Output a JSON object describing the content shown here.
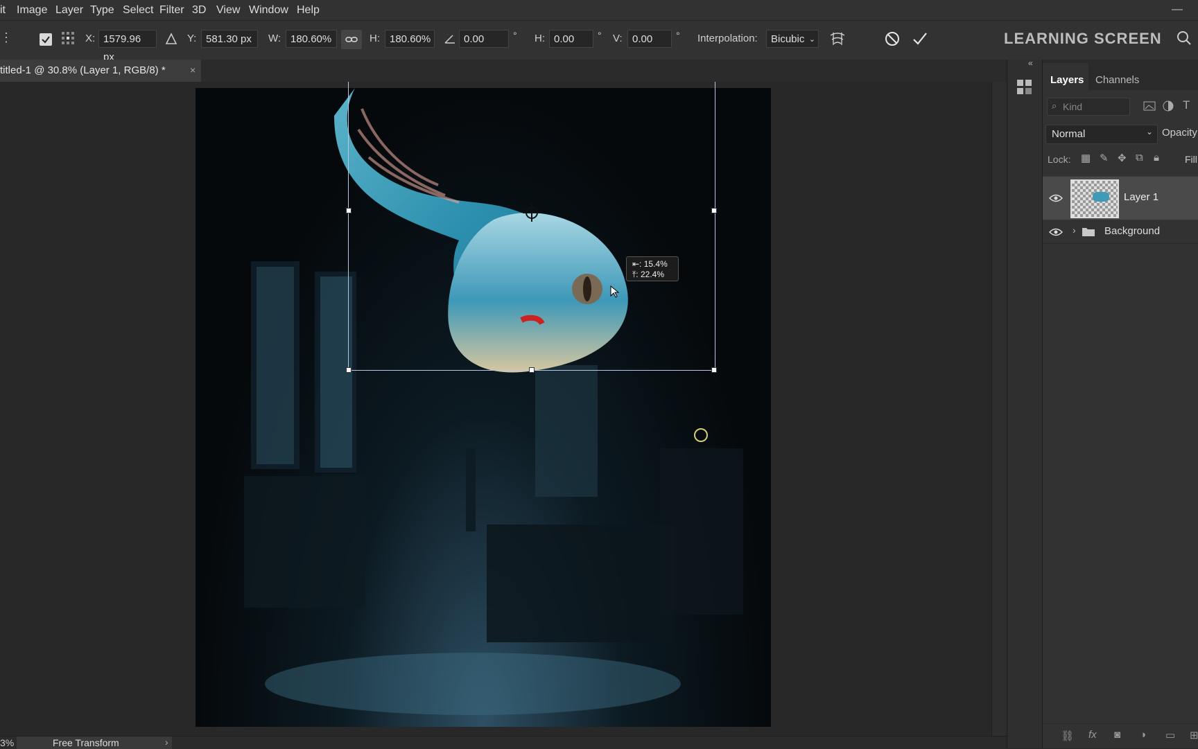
{
  "menu": [
    "it",
    "Image",
    "Layer",
    "Type",
    "Select",
    "Filter",
    "3D",
    "View",
    "Window",
    "Help"
  ],
  "options": {
    "x_label": "X:",
    "x_value": "1579.96 px",
    "y_label": "Y:",
    "y_value": "581.30 px",
    "w_label": "W:",
    "w_value": "180.60%",
    "h_label": "H:",
    "h_value": "180.60%",
    "angle_value": "0.00",
    "skew_h_label": "H:",
    "skew_h_value": "0.00",
    "skew_v_label": "V:",
    "skew_v_value": "0.00",
    "deg_symbol": "°",
    "interpolation_label": "Interpolation:",
    "interpolation_value": "Bicubic"
  },
  "brand": "LEARNING SCREEN",
  "document_tab": "titled-1 @ 30.8% (Layer 1, RGB/8) *",
  "transform_tooltip": {
    "line1": "⇤: 15.4%",
    "line2": "⤒: 22.4%"
  },
  "panel": {
    "tabs": [
      "Layers",
      "Channels"
    ],
    "filter_placeholder": "Kind",
    "blend_mode": "Normal",
    "opacity_label": "Opacity",
    "lock_label": "Lock:",
    "fill_label": "Fill",
    "layers": [
      {
        "name": "Layer 1",
        "visible": true,
        "selected": true
      },
      {
        "name": "Background",
        "visible": true,
        "selected": false
      }
    ]
  },
  "status": {
    "zoom": "3%",
    "mode": "Free Transform"
  },
  "colors": {
    "accent": "#4a90d9",
    "selection": "#4a4a4a"
  }
}
